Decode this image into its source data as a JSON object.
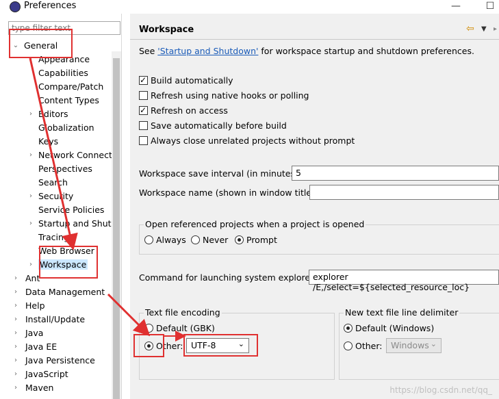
{
  "window": {
    "title": "Preferences",
    "minimize_icon": "minimize-icon",
    "close_icon": "close-icon"
  },
  "filter": {
    "placeholder": "type filter text"
  },
  "tree": {
    "general": "General",
    "children": [
      "Appearance",
      "Capabilities",
      "Compare/Patch",
      "Content Types",
      "Editors",
      "Globalization",
      "Keys",
      "Network Connecti",
      "Perspectives",
      "Search",
      "Security",
      "Service Policies",
      "Startup and Shutd",
      "Tracing",
      "Web Browser",
      "Workspace"
    ],
    "top_level": [
      "Ant",
      "Data Management",
      "Help",
      "Install/Update",
      "Java",
      "Java EE",
      "Java Persistence",
      "JavaScript",
      "Maven"
    ]
  },
  "page": {
    "title": "Workspace",
    "see_prefix": "See ",
    "see_link": "'Startup and Shutdown'",
    "see_suffix": " for workspace startup and shutdown preferences.",
    "checkboxes": [
      {
        "label": "Build automatically",
        "checked": true
      },
      {
        "label": "Refresh using native hooks or polling",
        "checked": false
      },
      {
        "label": "Refresh on access",
        "checked": true
      },
      {
        "label": "Save automatically before build",
        "checked": false
      },
      {
        "label": "Always close unrelated projects without prompt",
        "checked": false
      }
    ],
    "save_interval_label": "Workspace save interval (in minutes):",
    "save_interval_value": "5",
    "name_label": "Workspace name (shown in window title):",
    "name_value": "",
    "open_ref_title": "Open referenced projects when a project is opened",
    "open_ref_options": [
      "Always",
      "Never",
      "Prompt"
    ],
    "open_ref_selected": "Prompt",
    "explorer_label": "Command for launching system explorer:",
    "explorer_value": "explorer /E,/select=${selected_resource_loc}",
    "encoding_title": "Text file encoding",
    "encoding_default": "Default (GBK)",
    "encoding_other": "Other:",
    "encoding_value": "UTF-8",
    "delimiter_title": "New text file line delimiter",
    "delimiter_default": "Default (Windows)",
    "delimiter_other": "Other:",
    "delimiter_value": "Windows",
    "watermark": "https://blog.csdn.net/qq_"
  },
  "colors": {
    "annotation": "#e03030",
    "selection": "#cce8ff",
    "link": "#1a5bb8"
  }
}
